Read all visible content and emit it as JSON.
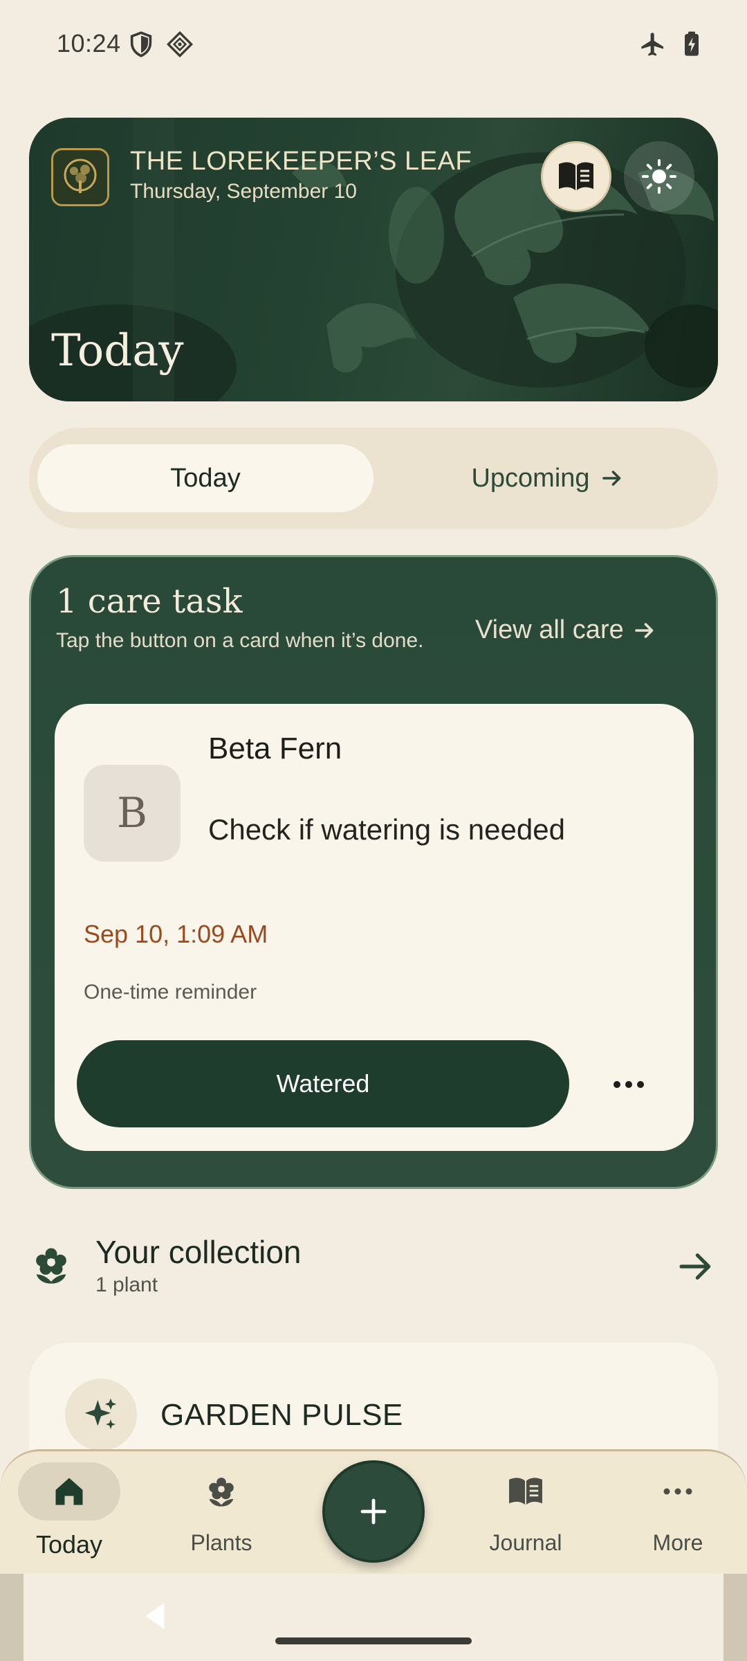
{
  "status_bar": {
    "time": "10:24",
    "left_icons": [
      "shield-icon",
      "diamond-icon"
    ],
    "right_icons": [
      "airplane-icon",
      "battery-charging-icon"
    ]
  },
  "hero": {
    "app_title": "THE LOREKEEPER’S LEAF",
    "date": "Thursday, September 10",
    "heading": "Today",
    "journal_button_icon": "book-icon",
    "theme_button_icon": "sun-icon"
  },
  "segmented": {
    "today_label": "Today",
    "upcoming_label": "Upcoming",
    "selected": "Today"
  },
  "care": {
    "count_label": "1 care task",
    "hint": "Tap the button on a card when it’s done.",
    "view_all_label": "View all care",
    "task": {
      "avatar_letter": "B",
      "plant_name": "Beta Fern",
      "action": "Check if watering is needed",
      "due": "Sep 10, 1:09 AM",
      "repeat": "One-time reminder",
      "primary_button": "Watered",
      "overflow_icon": "more-horizontal-icon"
    }
  },
  "collection": {
    "title": "Your collection",
    "subtitle": "1 plant"
  },
  "pulse": {
    "title": "GARDEN PULSE"
  },
  "bottom_nav": {
    "items": [
      {
        "label": "Today",
        "icon": "home-icon",
        "active": true
      },
      {
        "label": "Plants",
        "icon": "flower-icon",
        "active": false
      },
      {
        "label": "Journal",
        "icon": "book-icon",
        "active": false
      },
      {
        "label": "More",
        "icon": "more-horizontal-icon",
        "active": false
      }
    ],
    "fab_icon": "plus-icon"
  },
  "colors": {
    "background": "#f3ede1",
    "brand_green": "#1f3d2d",
    "panel_green": "#2c4b3a",
    "card": "#faf5eb",
    "due_accent": "#9b4a1e"
  }
}
